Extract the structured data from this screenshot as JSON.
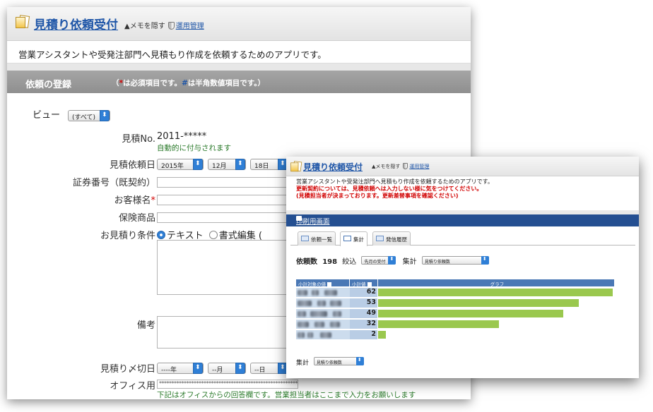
{
  "back": {
    "app_title": "見積り依頼受付",
    "memo_toggle": "▲メモを隠す",
    "admin_link": "運用管理",
    "description": "営業アシスタントや受発注部門へ見積もり作成を依頼するためのアプリです。",
    "section_title": "依頼の登録",
    "section_note_open": "（",
    "section_note_star": "*",
    "section_note_mid": "は必須項目です。",
    "section_note_hash": "#",
    "section_note_end": "は半角数値項目です。）",
    "view_label": "ビュー",
    "view_select": "(すべて)",
    "fields": {
      "estimate_no_label": "見積No.",
      "estimate_no_value": "2011-*****",
      "estimate_no_hint": "自動的に付与されます",
      "request_date_label": "見積依頼日",
      "request_year": "2015年",
      "request_month": "12月",
      "request_day": "18日",
      "policy_no_label": "証券番号（既契約）",
      "customer_label": "お客様名",
      "required_mark": "*",
      "insurance_label": "保険商品",
      "conditions_label": "お見積り条件",
      "radio_text": "テキスト",
      "radio_rich": "書式編集",
      "radio_rich_paren": "(",
      "remarks_label": "備考",
      "deadline_label": "見積り〆切日",
      "deadline_year": "----年",
      "deadline_month": "--月",
      "deadline_day": "--日",
      "office_label": "オフィス用",
      "office_value": "**********************************************************************************",
      "office_hint": "下記はオフィスからの回答欄です。営業担当者はここまで入力をお願いします"
    }
  },
  "front": {
    "app_title": "見積り依頼受付",
    "memo_toggle": "▲メモを隠す",
    "admin_link": "運用管理",
    "desc_line1": "営業アシスタントや受発注部門へ見積もり作成を依頼するためのアプリです。",
    "desc_line2": "更新契約については、見積依頼へは入力しない様に気をつけてください。",
    "desc_line3": "(見積担当者が決まっております。更新差替事項を確認ください)",
    "print_link": "印刷用画面",
    "tabs": [
      "依頼一覧",
      "集計",
      "発信履歴"
    ],
    "count_label": "依頼数",
    "count_value": "198",
    "filter_label": "絞込",
    "filter_value": "先月の受付",
    "aggregate_label": "集計",
    "aggregate_value": "見積り依頼数",
    "table_headers": [
      "小計対象の値",
      "小計値",
      "グラフ"
    ],
    "bottom_label": "集計",
    "bottom_select": "見積り依頼数"
  },
  "chart_data": {
    "type": "bar",
    "categories": [
      "",
      "",
      "",
      "",
      ""
    ],
    "values": [
      62,
      53,
      49,
      32,
      2
    ],
    "xlim": [
      0,
      62
    ],
    "colors": {
      "bar": "#9ac84e",
      "header": "#4a78b5"
    }
  }
}
